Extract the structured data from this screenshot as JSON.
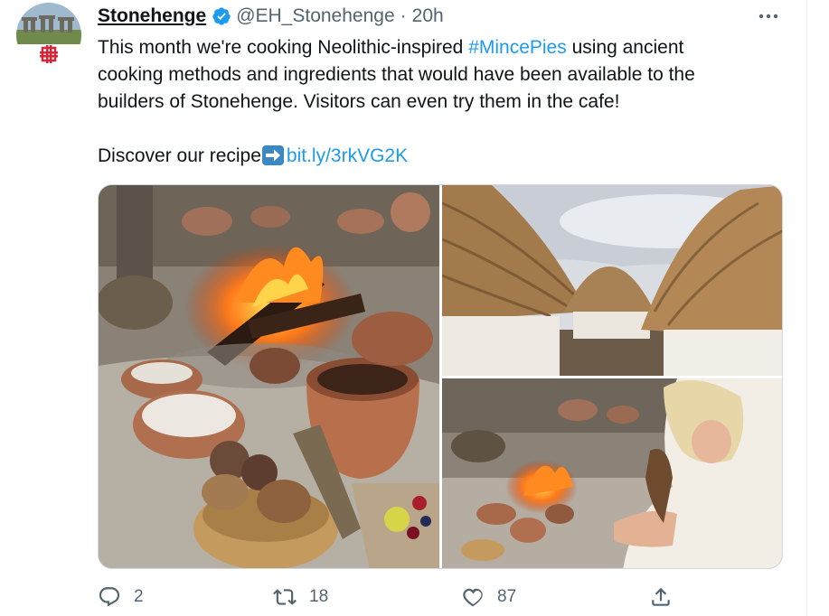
{
  "tweet": {
    "author_name": "Stonehenge",
    "handle": "@EH_Stonehenge",
    "separator": "·",
    "time": "20h",
    "text_line1_a": "This month we're cooking Neolithic-inspired ",
    "hashtag": "#MincePies",
    "text_line1_b": " using ancient cooking methods and ingredients that would have been available to the builders of Stonehenge. Visitors can even try them in the cafe!",
    "discover_text": "Discover our recipe",
    "link_text": "bit.ly/3rkVG2K"
  },
  "actions": {
    "replies": "2",
    "retweets": "18",
    "likes": "87"
  },
  "colors": {
    "link": "#1d9bf0",
    "verified": "#1d9bf0",
    "muted": "#536471"
  },
  "icons": [
    "verified-badge-icon",
    "more-icon",
    "right-arrow-emoji-icon",
    "reply-icon",
    "retweet-icon",
    "like-icon",
    "share-icon"
  ]
}
